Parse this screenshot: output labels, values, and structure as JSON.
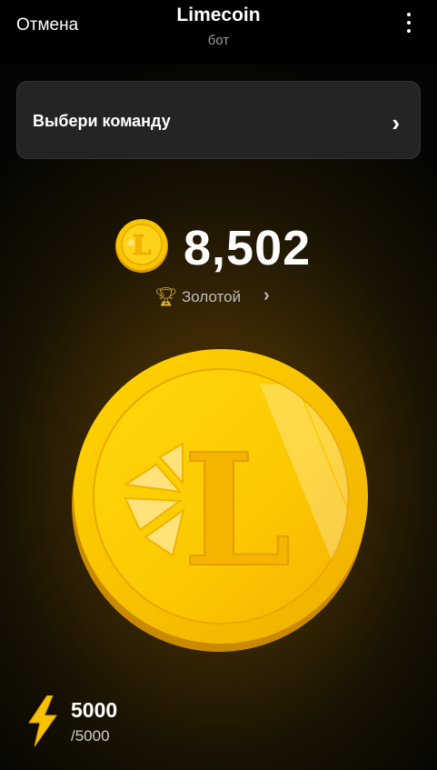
{
  "header": {
    "cancel_label": "Отмена",
    "title": "Limecoin",
    "subtitle": "бот",
    "menu_icon": "more-vertical-icon"
  },
  "team": {
    "label": "Выбери команду",
    "chevron_icon": "chevron-right-icon"
  },
  "balance": {
    "amount": "8,502",
    "coin_icon": "limecoin-icon"
  },
  "league": {
    "name": "Золотой",
    "icon": "trophy-icon",
    "chevron_icon": "chevron-right-icon"
  },
  "tap_coin": {
    "icon": "limecoin-tap-icon",
    "letter": "L"
  },
  "energy": {
    "current": "5000",
    "max": "/5000",
    "icon": "lightning-bolt-icon"
  },
  "colors": {
    "gold": "#f7c300",
    "gold_dark": "#e8a800",
    "background": "#000000",
    "card": "#242424"
  }
}
